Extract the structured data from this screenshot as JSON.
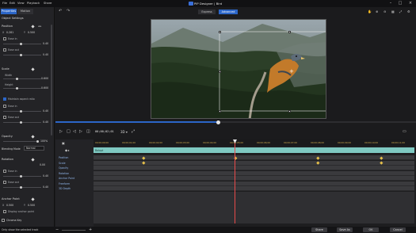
{
  "titlebar": {
    "menu": [
      "File",
      "Edit",
      "View",
      "Playback",
      "Share"
    ],
    "title": "PIP Designer | Bird"
  },
  "left_panel": {
    "tabs": [
      "Properties",
      "Motion"
    ],
    "object_settings": "Object Settings",
    "position": {
      "label": "Position",
      "x_label": "X",
      "x_value": "0.281",
      "y_label": "Y",
      "y_value": "0.500",
      "ease_in": "Ease in",
      "ease_in_value": "0.40",
      "ease_out": "Ease out",
      "ease_out_value": "0.40"
    },
    "scale": {
      "label": "Scale",
      "width_label": "Width",
      "width_value": "0.600",
      "height_label": "Height",
      "height_value": "0.600",
      "maintain_aspect": "Maintain aspect ratio",
      "ease_in": "Ease in",
      "ease_in_value": "0.40",
      "ease_out": "Ease out",
      "ease_out_value": "0.40"
    },
    "opacity": {
      "label": "Opacity",
      "value": "100%"
    },
    "blending": {
      "label": "Blending Mode",
      "value": "Normal"
    },
    "rotation": {
      "label": "Rotation",
      "value": "0.00",
      "ease_in": "Ease in",
      "ease_in_value": "0.40",
      "ease_out": "Ease out",
      "ease_out_value": "0.40"
    },
    "anchor": {
      "label": "Anchor Point",
      "x_label": "X",
      "x_value": "0.500",
      "y_label": "Y",
      "y_value": "0.500",
      "display_label": "Display anchor point"
    },
    "chroma_key": "Chroma Key"
  },
  "preview": {
    "view_modes": [
      "Express",
      "Advanced"
    ],
    "active_view": "Advanced"
  },
  "playback": {
    "timecode": "00;00;02;01"
  },
  "timeline": {
    "clip_name": "Balopt",
    "tracks": [
      "Position",
      "Scale",
      "Opacity",
      "Rotation",
      "Anchor Point",
      "Freeform",
      "3D Depth"
    ],
    "ruler": [
      "00;00;00;00",
      "00;00;01;00",
      "00;00;02;00",
      "00;00;03;00",
      "00;00;04;00",
      "00;00;05;00",
      "00;00;06;00",
      "00;00;07;00",
      "00;00;08;00",
      "00;00;09;00",
      "00;00;10;00",
      "00;00;11;00"
    ],
    "playhead_fraction": 0.44
  },
  "status": {
    "message": "Only show the selected track",
    "buttons": [
      "Share",
      "Save As",
      "OK",
      "Cancel"
    ]
  },
  "colors": {
    "accent": "#2c66c8",
    "clip": "#7fc9c2",
    "playhead": "#e84a4a",
    "keyframe": "#e6c04a"
  }
}
